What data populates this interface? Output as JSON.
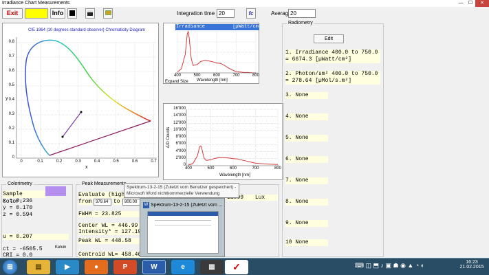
{
  "window": {
    "title": "Irradiance Chart Measurements",
    "min": "—",
    "max": "☐",
    "close": "✕"
  },
  "toolbar": {
    "exit_label": "Exit",
    "yellow_label": "",
    "info_label": "Info",
    "integration_label": "Integration time [ms]",
    "integration_value": "20",
    "average_label": "Average:",
    "average_value": "20"
  },
  "cie": {
    "title": "CIE 1964 (10 degrees standard observer) Chromaticity Diagram",
    "xlabel": "x",
    "ylabel": "y",
    "x_ticks": [
      "0",
      "0.1",
      "0.2",
      "0.3",
      "0.4",
      "0.5",
      "0.6",
      "0.7"
    ],
    "y_ticks": [
      "0.8",
      "0.7",
      "0.6",
      "0.5",
      "0.4",
      "0.3",
      "0.2",
      "0.1",
      "0"
    ]
  },
  "chart_data": [
    {
      "type": "line",
      "title": "Irradiance [µWatt/cm²]",
      "xlabel": "Wavelength [nm]",
      "ylabel": "",
      "xlim": [
        400,
        800
      ],
      "x_ticks": [
        "400",
        "500",
        "600",
        "700",
        "800"
      ],
      "x": [
        400,
        420,
        440,
        450,
        455,
        460,
        470,
        480,
        500,
        520,
        540,
        560,
        580,
        600,
        620,
        640,
        660,
        680,
        700,
        720,
        740,
        760,
        780,
        800
      ],
      "y": [
        0.02,
        0.1,
        0.45,
        0.95,
        1.0,
        0.85,
        0.35,
        0.18,
        0.2,
        0.28,
        0.3,
        0.29,
        0.27,
        0.24,
        0.23,
        0.18,
        0.12,
        0.07,
        0.03,
        0.02,
        0.01,
        0.01,
        0.0,
        0.0
      ]
    },
    {
      "type": "line",
      "title": "",
      "xlabel": "Wavelength [nm]",
      "ylabel": "A/D Counts",
      "xlim": [
        400,
        800
      ],
      "ylim": [
        0,
        16000
      ],
      "x_ticks": [
        "400",
        "500",
        "600",
        "700",
        "800"
      ],
      "y_ticks": [
        "16'000",
        "14'000",
        "12'000",
        "10'000",
        "8'000",
        "6'000",
        "4'000",
        "2'000",
        "0"
      ],
      "x": [
        400,
        420,
        440,
        450,
        455,
        460,
        470,
        480,
        500,
        520,
        540,
        560,
        580,
        600,
        620,
        640,
        660,
        680,
        700,
        720,
        740,
        760,
        780,
        800
      ],
      "y": [
        200,
        600,
        2800,
        5400,
        5600,
        4800,
        2100,
        1500,
        1700,
        2100,
        2300,
        2300,
        2200,
        2000,
        1900,
        1600,
        1300,
        1000,
        700,
        600,
        500,
        450,
        400,
        350
      ]
    }
  ],
  "chart_labels": {
    "irr_title": "Irradiance",
    "irr_unit": "[µWatt/cm",
    "expand": "Expand Size"
  },
  "colorimetry": {
    "title": "Colorimetry",
    "sample_label": "Sample Color:",
    "sample_color": "#b48ff0",
    "x": "x = 0.236",
    "y": "y = 0.170",
    "z": "z = 0.594",
    "u": "u = 0.207",
    "ct": "ct = -6505.5",
    "kelvin": "Kelvin",
    "cri": "CRI = 0.0"
  },
  "peak": {
    "title": "Peak Measurements",
    "evaluate": "Evaluate (highest",
    "from_label": "from",
    "from_value": "379.64",
    "to_label": "to",
    "to_value": "800.00",
    "fwhm": "FWHM      = 23.825",
    "center": "Center WL  = 446.99",
    "intensity": "Intensity* = 127.19",
    "peakwl": "Peak WL    = 448.58",
    "centroid": "Centroid WL= 458.46",
    "lux_value": "11809",
    "lux_unit": "Lux"
  },
  "radiometry": {
    "title": "Radiometry",
    "edit_label": "Edit",
    "rows": [
      {
        "line1": "1. Irradiance 400.0 to 750.0",
        "line2": "= 6674.3      [µWatt/cm²]"
      },
      {
        "line1": "2. Photon/sm² 400.0 to 750.0",
        "line2": "= 278.64      [µMol/s.m²]"
      },
      {
        "line1": "3. None"
      },
      {
        "line1": "4. None"
      },
      {
        "line1": "5. None"
      },
      {
        "line1": "6. None"
      },
      {
        "line1": "7. None"
      },
      {
        "line1": "8. None"
      },
      {
        "line1": "9. None"
      },
      {
        "line1": "10 None"
      }
    ]
  },
  "tooltip": {
    "line1": "Spektrum-13-2-15 (Zuletzt vom Benutzer gespeichert) -",
    "line2": "Microsoft Word nichtkommerzielle Verwendung"
  },
  "thumbnail": {
    "title": "Spektrum-13-2-15 (Zuletzt vom ..."
  },
  "taskbar": {
    "time": "16:23",
    "date": "21.02.2015",
    "icons": [
      "windows-start",
      "explorer",
      "media-player",
      "firefox",
      "powerpoint",
      "word",
      "internet-explorer",
      "irradiance-app"
    ]
  }
}
